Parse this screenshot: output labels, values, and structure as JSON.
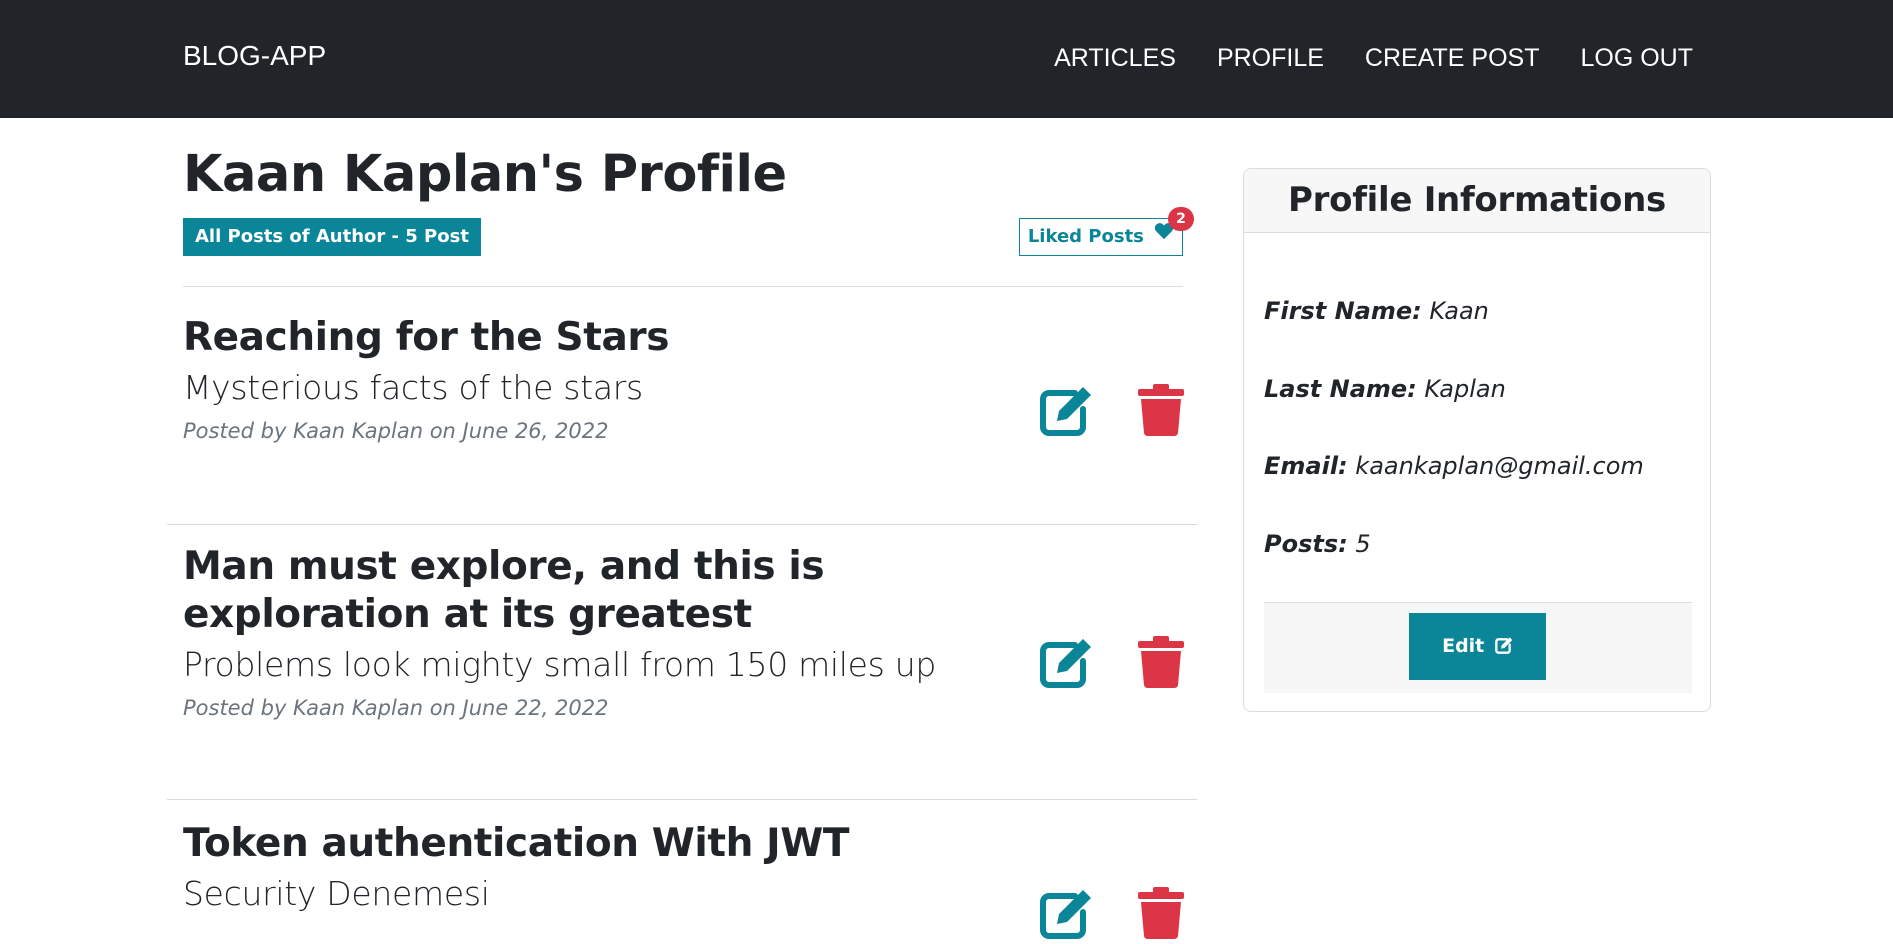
{
  "navbar": {
    "brand": "BLOG-APP",
    "links": [
      "ARTICLES",
      "PROFILE",
      "CREATE POST",
      "LOG OUT"
    ]
  },
  "profile": {
    "title": "Kaan Kaplan's Profile",
    "posts_badge": "All Posts of Author - 5 Post",
    "liked_label": "Liked Posts",
    "liked_count": "2"
  },
  "posts": [
    {
      "title": "Reaching for the Stars",
      "subtitle": "Mysterious facts of the stars",
      "meta": "Posted by Kaan Kaplan on June 26, 2022"
    },
    {
      "title": "Man must explore, and this is exploration at its greatest",
      "subtitle": "Problems look mighty small from 150 miles up",
      "meta": "Posted by Kaan Kaplan on June 22, 2022"
    },
    {
      "title": "Token authentication With JWT",
      "subtitle": "Security Denemesi",
      "meta": ""
    }
  ],
  "card": {
    "header": "Profile Informations",
    "first_name_label": "First Name:",
    "first_name": "Kaan",
    "last_name_label": "Last Name:",
    "last_name": "Kaplan",
    "email_label": "Email:",
    "email": "kaankaplan@gmail.com",
    "posts_label": "Posts:",
    "posts_value": "5",
    "edit_label": "Edit"
  },
  "colors": {
    "navbar": "#212529",
    "teal": "#0b8598",
    "red": "#dc3545",
    "muted": "#6c757d"
  },
  "icons": [
    "edit-icon",
    "trash-icon",
    "heart-icon"
  ]
}
